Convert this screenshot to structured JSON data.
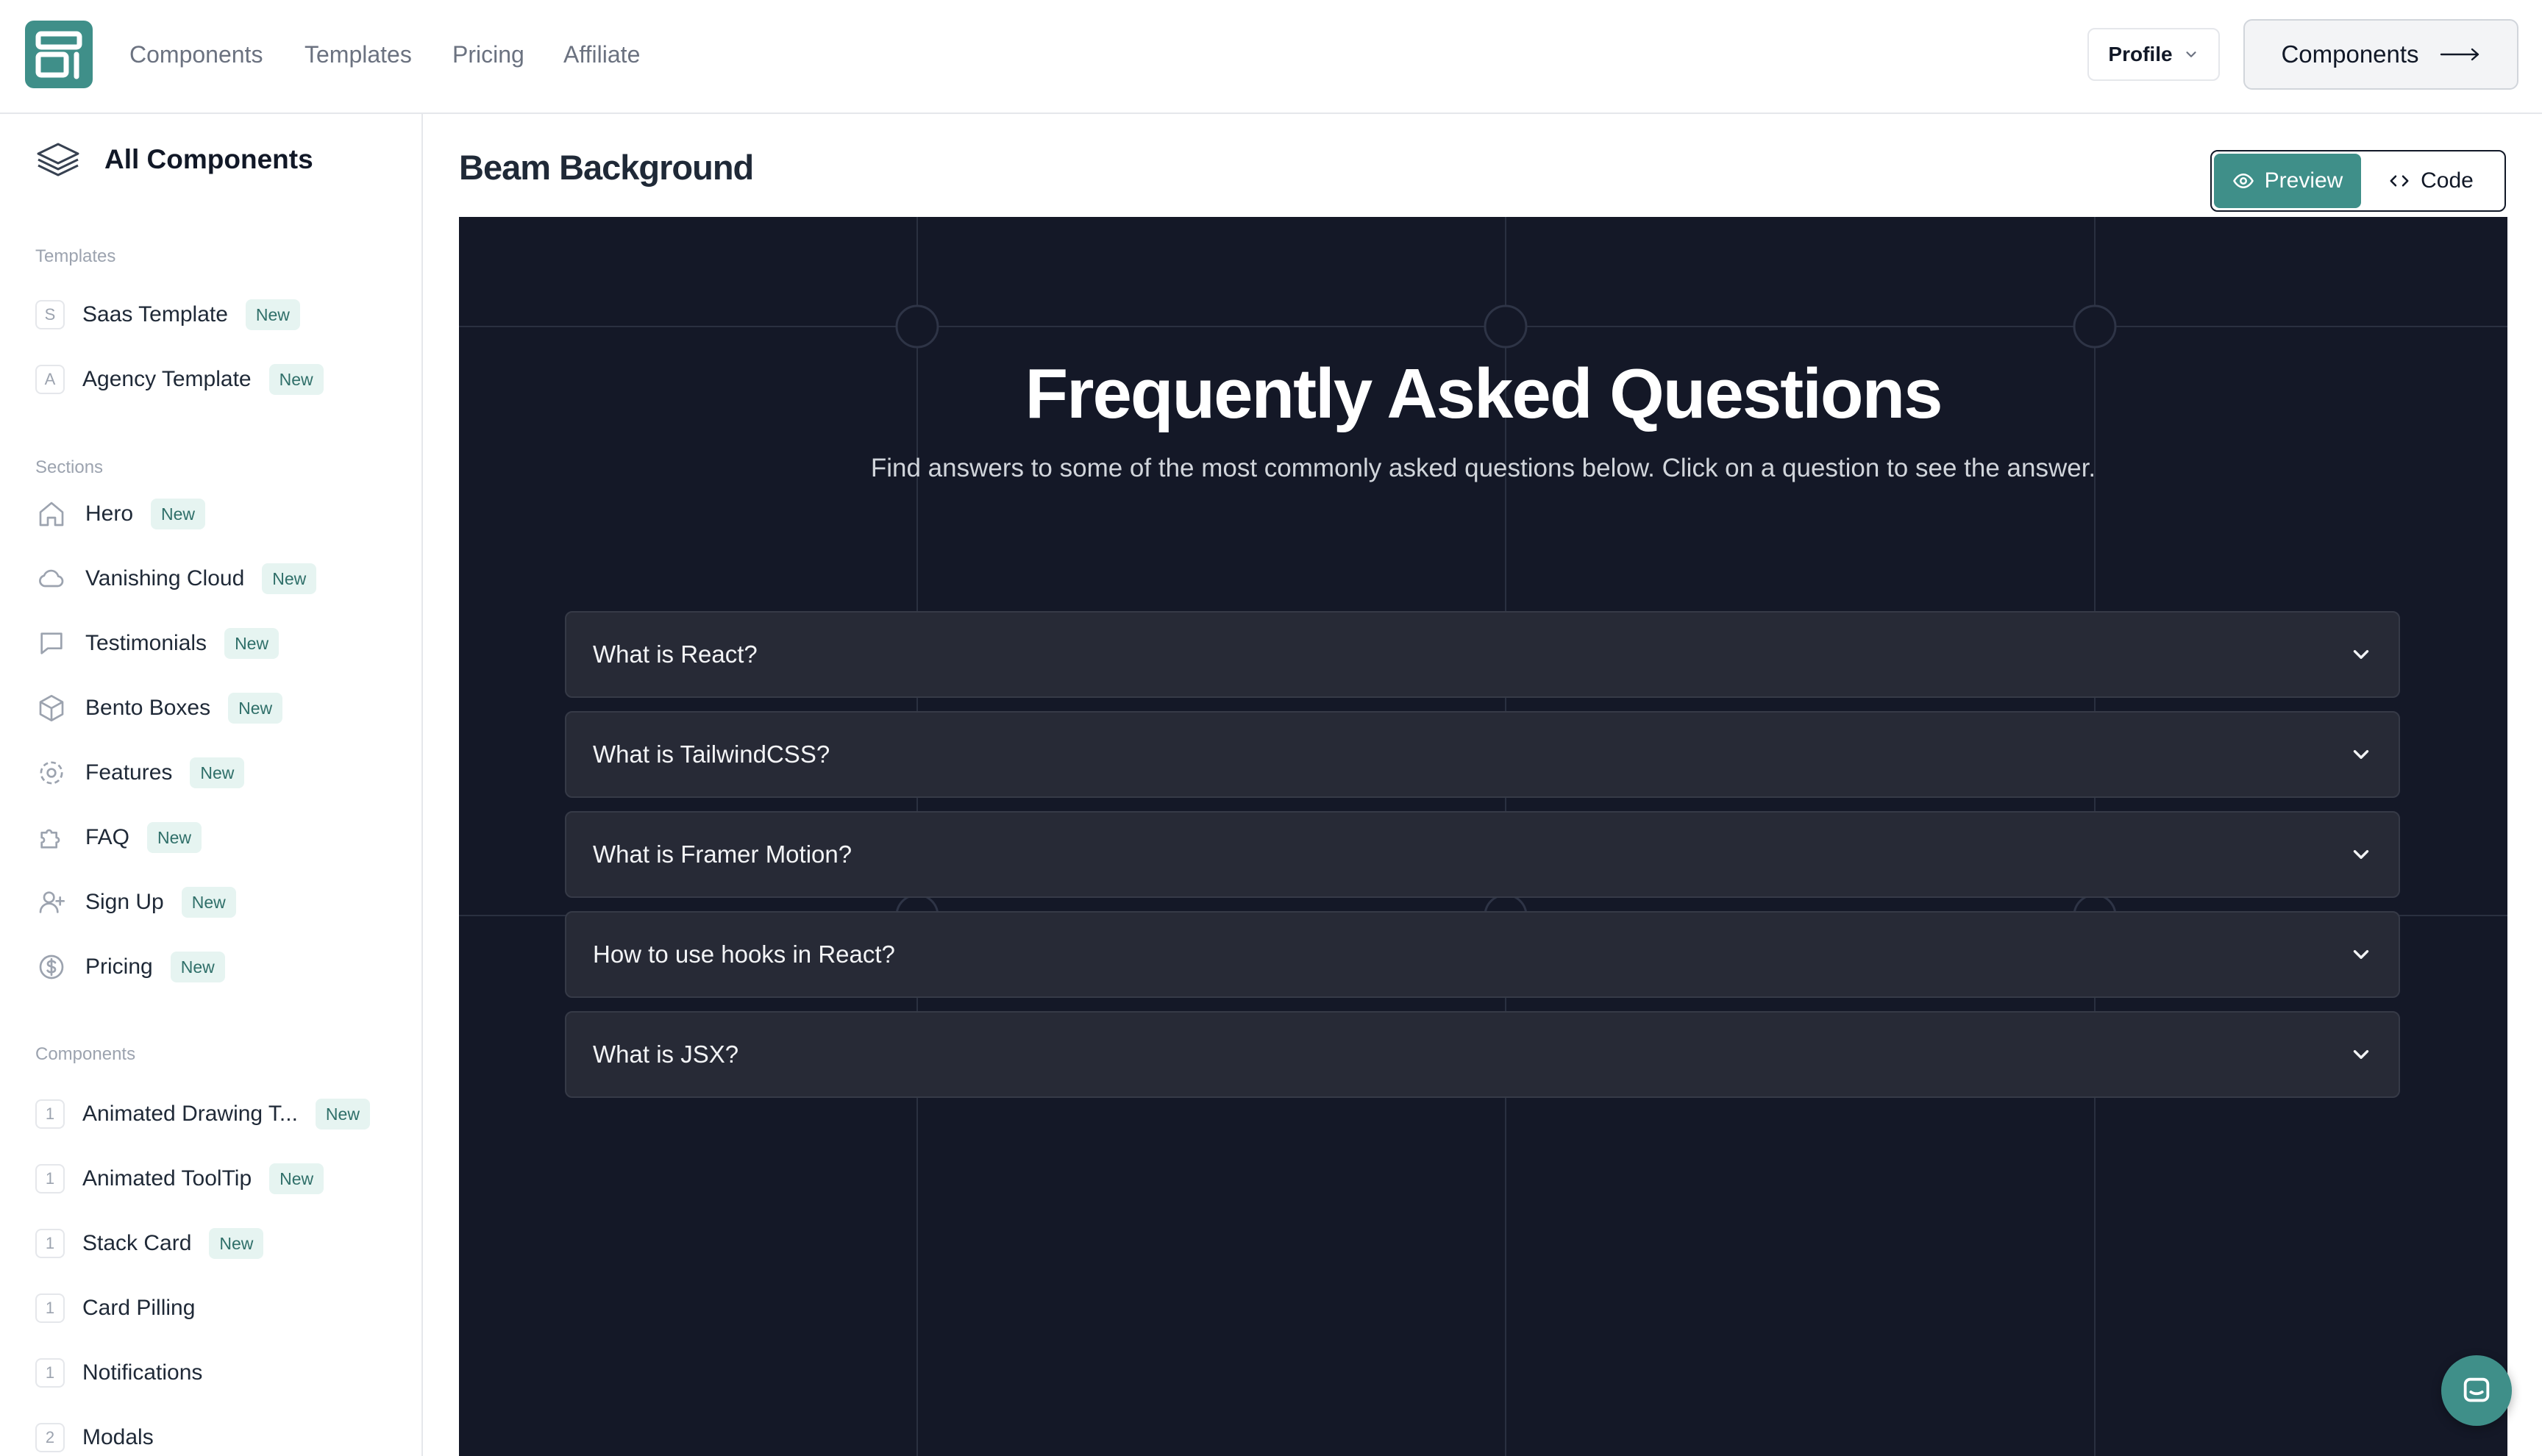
{
  "nav": {
    "links": [
      "Components",
      "Templates",
      "Pricing",
      "Affiliate"
    ],
    "profile_label": "Profile",
    "cta_label": "Components"
  },
  "sidebar": {
    "all_components": "All Components",
    "templates_label": "Templates",
    "templates": [
      {
        "letter": "S",
        "label": "Saas Template",
        "badge": "New"
      },
      {
        "letter": "A",
        "label": "Agency Template",
        "badge": "New"
      }
    ],
    "sections_label": "Sections",
    "sections": [
      {
        "icon": "home-icon",
        "label": "Hero",
        "badge": "New"
      },
      {
        "icon": "cloud-icon",
        "label": "Vanishing Cloud",
        "badge": "New"
      },
      {
        "icon": "message-square-icon",
        "label": "Testimonials",
        "badge": "New"
      },
      {
        "icon": "box-icon",
        "label": "Bento Boxes",
        "badge": "New"
      },
      {
        "icon": "settings-icon",
        "label": "Features",
        "badge": "New"
      },
      {
        "icon": "puzzle-icon",
        "label": "FAQ",
        "badge": "New"
      },
      {
        "icon": "user-plus-icon",
        "label": "Sign Up",
        "badge": "New"
      },
      {
        "icon": "dollar-circle-icon",
        "label": "Pricing",
        "badge": "New"
      }
    ],
    "components_label": "Components",
    "components": [
      {
        "count": "1",
        "label": "Animated Drawing T...",
        "badge": "New"
      },
      {
        "count": "1",
        "label": "Animated ToolTip",
        "badge": "New"
      },
      {
        "count": "1",
        "label": "Stack Card",
        "badge": "New"
      },
      {
        "count": "1",
        "label": "Card Pilling",
        "badge": ""
      },
      {
        "count": "1",
        "label": "Notifications",
        "badge": ""
      },
      {
        "count": "2",
        "label": "Modals",
        "badge": ""
      }
    ]
  },
  "main": {
    "title": "Beam Background",
    "preview_label": "Preview",
    "code_label": "Code"
  },
  "preview": {
    "heading": "Frequently Asked Questions",
    "subheading": "Find answers to some of the most commonly asked questions below. Click on a question to see the answer.",
    "questions": [
      "What is React?",
      "What is TailwindCSS?",
      "What is Framer Motion?",
      "How to use hooks in React?",
      "What is JSX?"
    ]
  },
  "colors": {
    "accent": "#3f8f89",
    "badge_bg": "#e6f4f1",
    "preview_bg": "#141827",
    "faq_item_bg": "#272a36"
  }
}
